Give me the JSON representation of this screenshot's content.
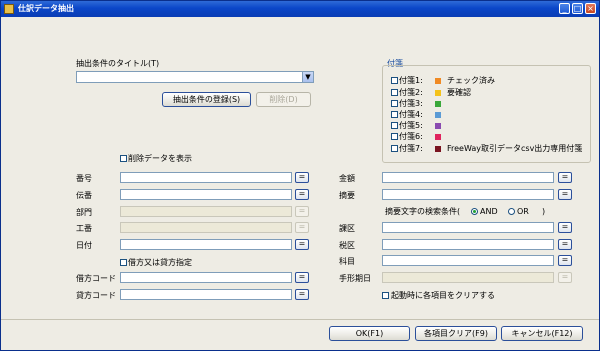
{
  "window": {
    "title": "仕訳データ抽出"
  },
  "extract_title": {
    "label": "抽出条件のタイトル(T)",
    "value": "",
    "register_label": "抽出条件の登録(S)",
    "delete_label": "削除(D)"
  },
  "show_deleted": {
    "label": "削除データを表示",
    "checked": false
  },
  "sticky": {
    "title": "付箋",
    "items": [
      {
        "label": "付箋1:",
        "name": "チェック済み",
        "color": "#f08a24"
      },
      {
        "label": "付箋2:",
        "name": "要確認",
        "color": "#f4c21a"
      },
      {
        "label": "付箋3:",
        "name": "",
        "color": "#3aa83a"
      },
      {
        "label": "付箋4:",
        "name": "",
        "color": "#5b9bd5"
      },
      {
        "label": "付箋5:",
        "name": "",
        "color": "#8a4bb0"
      },
      {
        "label": "付箋6:",
        "name": "",
        "color": "#e0245e"
      },
      {
        "label": "付箋7:",
        "name": "FreeWay取引データcsv出力専用付箋",
        "color": "#7a1420"
      }
    ]
  },
  "fields_left": {
    "number": {
      "label": "番号",
      "value": "",
      "eq": "="
    },
    "voucher": {
      "label": "伝番",
      "value": "",
      "eq": "="
    },
    "department": {
      "label": "部門",
      "value": "",
      "eq": "="
    },
    "work_number": {
      "label": "工番",
      "value": "",
      "eq": "="
    },
    "date": {
      "label": "日付",
      "value": "",
      "eq": "="
    },
    "debit_credit_check": {
      "label": "借方又は貸方指定",
      "checked": false
    },
    "debit_code": {
      "label": "借方コード",
      "value": "",
      "eq": "="
    },
    "credit_code": {
      "label": "貸方コード",
      "value": "",
      "eq": "="
    }
  },
  "fields_right": {
    "amount": {
      "label": "金額",
      "value": "",
      "eq": "="
    },
    "summary": {
      "label": "摘要",
      "value": "",
      "eq": "="
    },
    "summary_search": {
      "label": "摘要文字の検索条件(",
      "and": "AND",
      "or": "OR",
      "close": ")"
    },
    "tax_class": {
      "label": "課区",
      "value": "",
      "eq": "="
    },
    "tax_rate": {
      "label": "税区",
      "value": "",
      "eq": "="
    },
    "subject": {
      "label": "科目",
      "value": "",
      "eq": "="
    },
    "bill_due": {
      "label": "手形期日",
      "value": "",
      "eq": "="
    },
    "clear_on_start": {
      "label": "起動時に各項目をクリアする",
      "checked": false
    }
  },
  "footer": {
    "ok": "OK(F1)",
    "clear": "各項目クリア(F9)",
    "cancel": "キャンセル(F12)"
  }
}
